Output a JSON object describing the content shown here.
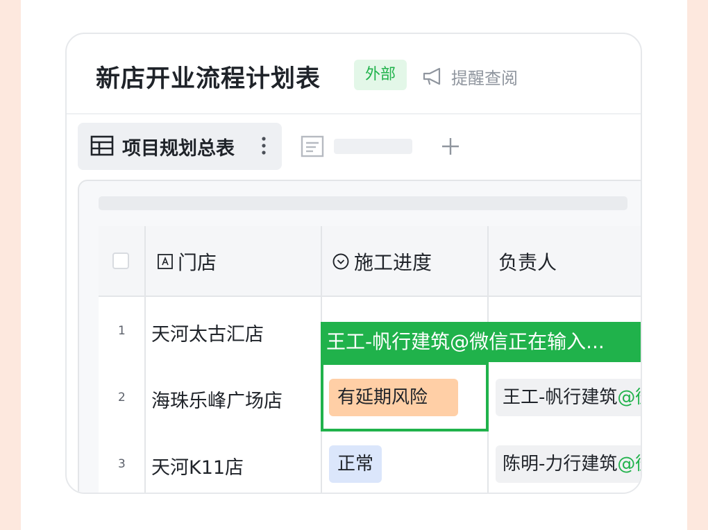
{
  "doc": {
    "title": "新店开业流程计划表",
    "badge": "外部",
    "remind_label": "提醒查阅"
  },
  "tabs": {
    "active_label": "项目规划总表",
    "second_label": "",
    "add_label": ""
  },
  "table": {
    "columns": [
      "门店",
      "施工进度",
      "负责人"
    ],
    "rows": [
      {
        "num": "1",
        "store": "天河太古汇店",
        "progress": "",
        "owner_name": "",
        "owner_suffix": ""
      },
      {
        "num": "2",
        "store": "海珠乐峰广场店",
        "progress": "有延期风险",
        "owner_name": "王工-帆行建筑",
        "owner_suffix": "@微"
      },
      {
        "num": "3",
        "store": "天河K11店",
        "progress": "正常",
        "owner_name": "陈明-力行建筑",
        "owner_suffix": "@微"
      }
    ],
    "typing_notice": "王工-帆行建筑@微信正在输入..."
  },
  "colors": {
    "accent_green": "#20b24b",
    "tag_delay": "#ffcfa6",
    "tag_normal": "#dbe6fb",
    "background": "#fde8de"
  },
  "icons": [
    "megaphone-icon",
    "grid-table-icon",
    "more-vertical-icon",
    "form-icon",
    "plus-icon",
    "text-field-icon",
    "single-select-icon"
  ]
}
